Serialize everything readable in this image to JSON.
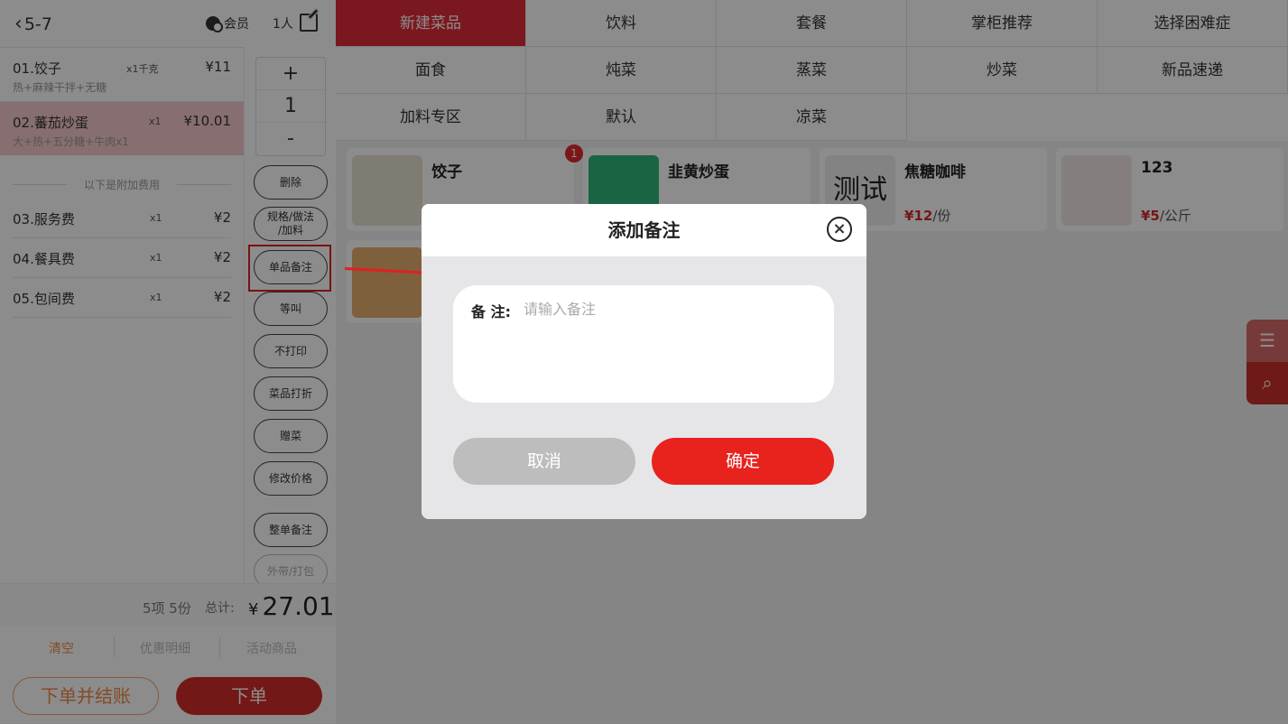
{
  "header": {
    "table": "5-7",
    "member": "会员",
    "people": "1人"
  },
  "order_items": [
    {
      "name": "01.饺子",
      "qty": "x1千克",
      "price": "¥11",
      "options": "热+麻辣干拌+无糖",
      "selected": false
    },
    {
      "name": "02.蕃茄炒蛋",
      "qty": "x1",
      "price": "¥10.01",
      "options": "大+热+五分糖+牛肉x1",
      "selected": true
    }
  ],
  "extra_title": "以下是附加费用",
  "fees": [
    {
      "name": "03.服务费",
      "qty": "x1",
      "price": "¥2"
    },
    {
      "name": "04.餐具费",
      "qty": "x1",
      "price": "¥2"
    },
    {
      "name": "05.包间费",
      "qty": "x1",
      "price": "¥2"
    }
  ],
  "stepper": {
    "plus": "+",
    "value": "1",
    "minus": "-"
  },
  "ops": {
    "delete": "删除",
    "spec_l1": "规格/做法",
    "spec_l2": "/加料",
    "item_note": "单品备注",
    "wait": "等叫",
    "no_print": "不打印",
    "discount": "菜品打折",
    "gift": "赠菜",
    "change_price": "修改价格",
    "order_note": "整单备注",
    "takeout": "外带/打包"
  },
  "summary": {
    "count": "5项 5份",
    "total_label": "总计:",
    "currency": "¥",
    "total": "27.01"
  },
  "bottom_tabs": {
    "clear": "清空",
    "discount_detail": "优惠明细",
    "promo": "活动商品"
  },
  "buttons": {
    "order_pay": "下单并结账",
    "order": "下单"
  },
  "categories": [
    "新建菜品",
    "饮料",
    "套餐",
    "掌柜推荐",
    "选择困难症",
    "面食",
    "炖菜",
    "蒸菜",
    "炒菜",
    "新品速递",
    "加料专区",
    "默认",
    "凉菜"
  ],
  "products": [
    {
      "name": "饺子",
      "badge": "1"
    },
    {
      "name": "韭黄炒蛋"
    },
    {
      "name": "焦糖咖啡",
      "price": "¥12",
      "unit": "/份",
      "thumb_text": "测试"
    },
    {
      "name": "123",
      "price": "¥5",
      "unit": "/公斤"
    }
  ],
  "dialog": {
    "title": "添加备注",
    "note_label": "备 注:",
    "note_placeholder": "请输入备注",
    "note_value": "",
    "cancel": "取消",
    "confirm": "确定"
  },
  "colors": {
    "accent_red": "#e02a3a",
    "orange": "#f08a4a"
  }
}
